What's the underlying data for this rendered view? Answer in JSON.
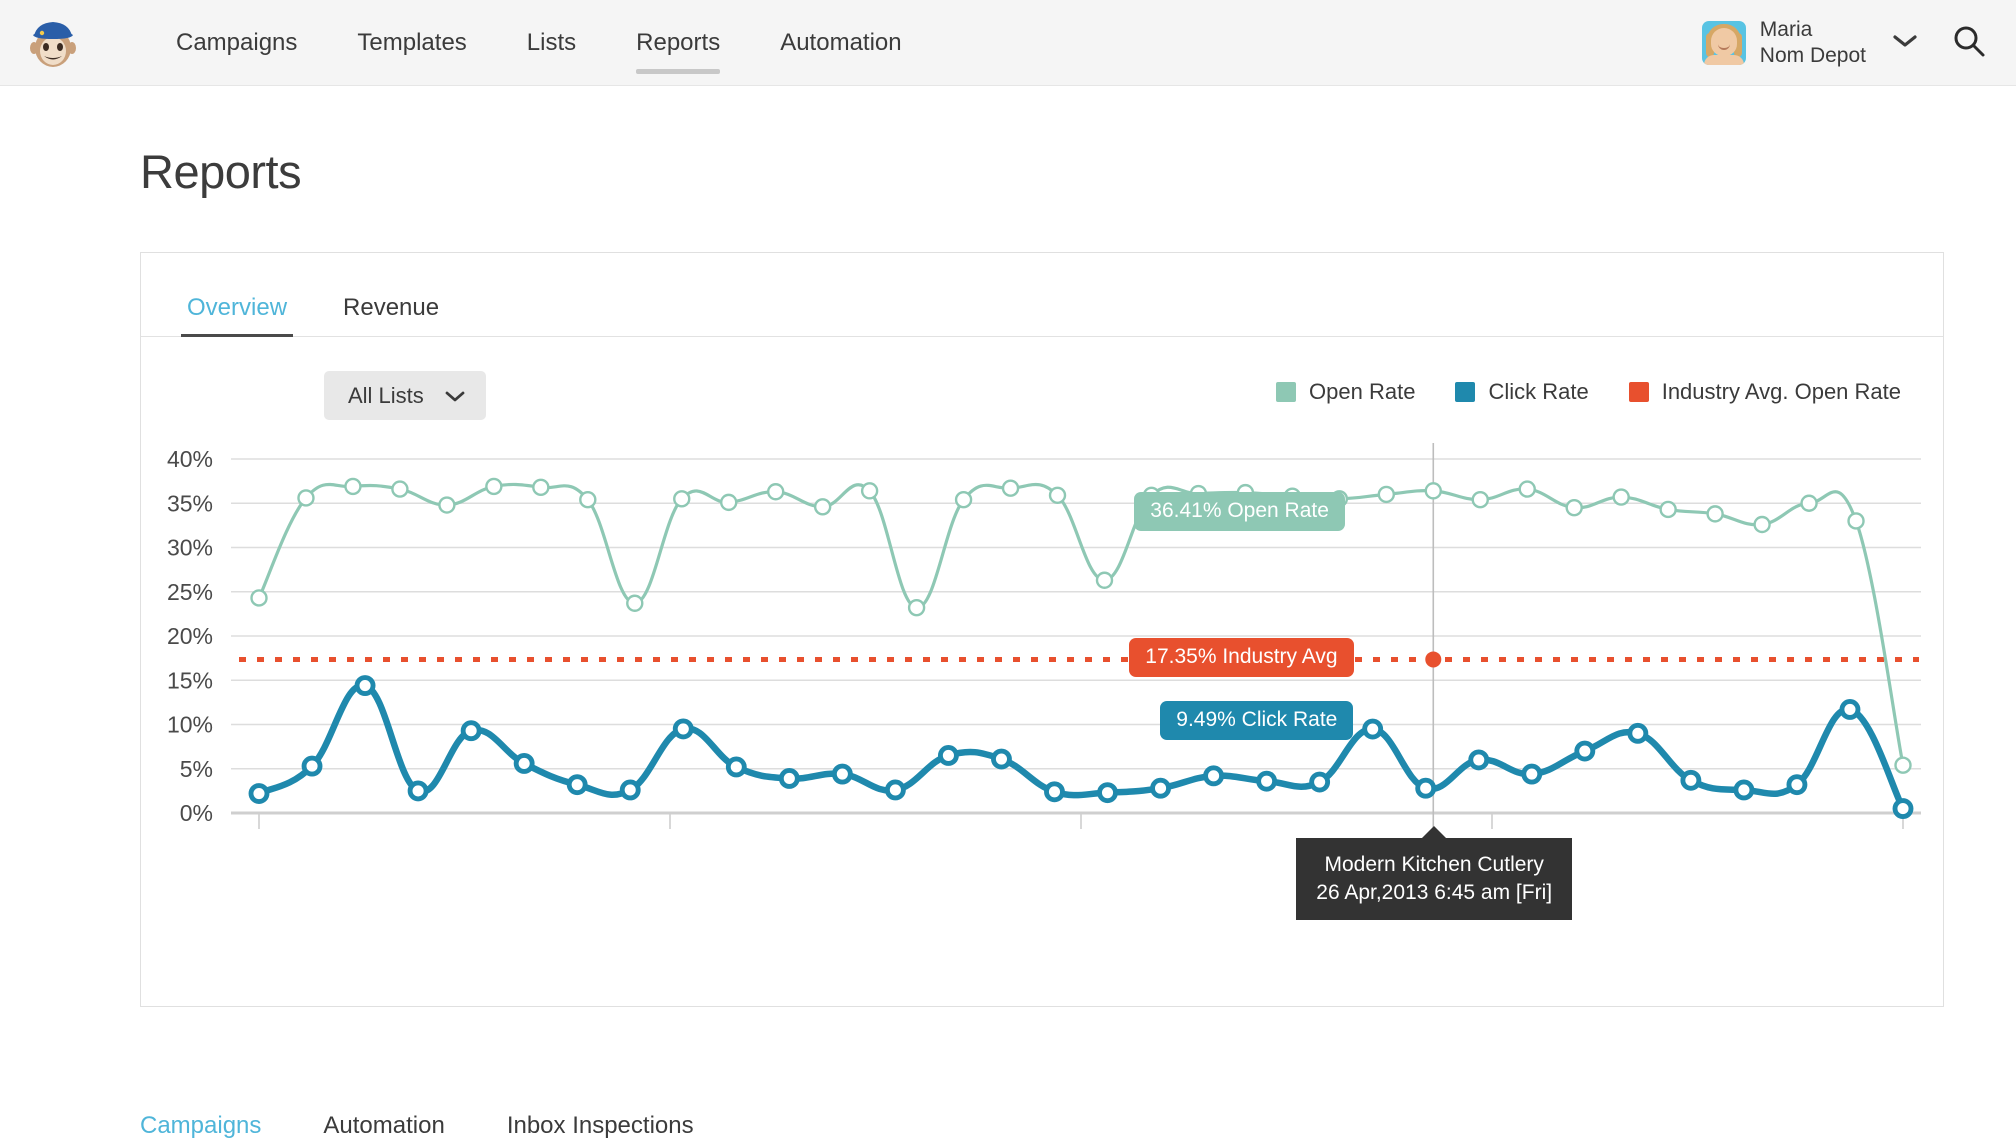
{
  "header": {
    "logo_icon": "mailchimp-freddie-logo",
    "nav": [
      {
        "label": "Campaigns",
        "active": false
      },
      {
        "label": "Templates",
        "active": false
      },
      {
        "label": "Lists",
        "active": false
      },
      {
        "label": "Reports",
        "active": true
      },
      {
        "label": "Automation",
        "active": false
      }
    ],
    "user": {
      "name": "Maria",
      "account": "Nom Depot",
      "avatar_icon": "user-avatar",
      "caret_icon": "chevron-down-icon"
    },
    "search_icon": "search-icon"
  },
  "page": {
    "title": "Reports"
  },
  "card": {
    "tabs": [
      {
        "label": "Overview",
        "active": true
      },
      {
        "label": "Revenue",
        "active": false
      }
    ],
    "filter": {
      "label": "All Lists",
      "caret_icon": "chevron-down-icon"
    }
  },
  "bottom_tabs": [
    {
      "label": "Campaigns",
      "active": true
    },
    {
      "label": "Automation",
      "active": false
    },
    {
      "label": "Inbox Inspections",
      "active": false
    }
  ],
  "colors": {
    "open_rate": "#8ec8b4",
    "click_rate": "#1f89ad",
    "industry_avg": "#e8502e",
    "accent": "#4fb5d9",
    "grid": "#dddddd",
    "tooltip_bg": "#333333"
  },
  "tooltips": {
    "open_rate": "36.41% Open Rate",
    "industry_avg": "17.35% Industry Avg",
    "click_rate": "9.49% Click Rate",
    "campaign_name": "Modern Kitchen Cutlery",
    "campaign_date": "26 Apr,2013 6:45 am [Fri]"
  },
  "chart_data": {
    "type": "line",
    "title": "",
    "xlabel": "",
    "ylabel": "",
    "ylim": [
      0,
      40
    ],
    "yticks": [
      "0%",
      "5%",
      "10%",
      "15%",
      "20%",
      "25%",
      "30%",
      "35%",
      "40%"
    ],
    "ytick_values": [
      0,
      5,
      10,
      15,
      20,
      25,
      30,
      35,
      40
    ],
    "grid": true,
    "legend_position": "top-right",
    "xticks_labeled": false,
    "x_tick_count": 5,
    "n_points": 40,
    "highlight_index": 25,
    "series": [
      {
        "name": "Open Rate",
        "color": "#8ec8b4",
        "values": [
          24.3,
          35.6,
          36.9,
          36.6,
          34.8,
          36.9,
          36.8,
          35.4,
          23.7,
          35.5,
          35.1,
          36.3,
          34.6,
          36.4,
          23.2,
          35.4,
          36.7,
          35.9,
          26.3,
          35.9,
          36.1,
          36.2,
          35.8,
          35.5,
          36.0,
          36.4,
          35.4,
          36.6,
          34.5,
          35.7,
          34.3,
          33.8,
          32.6,
          35.0,
          33.0,
          5.4
        ]
      },
      {
        "name": "Click Rate",
        "color": "#1f89ad",
        "values": [
          2.2,
          5.3,
          14.4,
          2.5,
          9.3,
          5.6,
          3.2,
          2.6,
          9.5,
          5.2,
          3.9,
          4.4,
          2.6,
          6.5,
          6.1,
          2.4,
          2.3,
          2.8,
          4.2,
          3.6,
          3.5,
          9.49,
          2.8,
          6.0,
          4.4,
          7.0,
          9.0,
          3.7,
          2.6,
          3.2,
          11.7,
          0.5
        ]
      },
      {
        "name": "Industry Avg. Open Rate",
        "color": "#e8502e",
        "style": "dotted-horizontal",
        "value": 17.35
      }
    ]
  }
}
